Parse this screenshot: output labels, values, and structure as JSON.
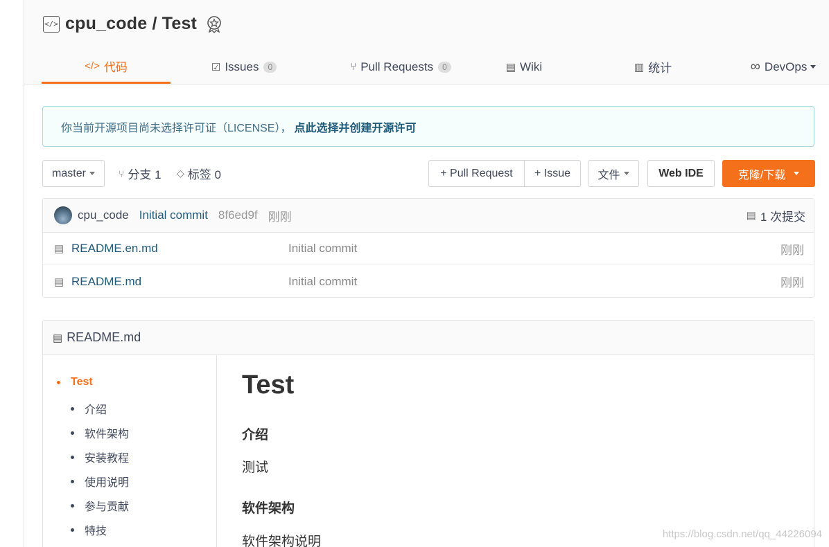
{
  "repo": {
    "title": "cpu_code / Test",
    "repo_icon": "repo-code-icon",
    "badge_icon": "award-badge-icon"
  },
  "tabs": [
    {
      "label": "代码",
      "icon": "code-icon",
      "active": true
    },
    {
      "label": "Issues",
      "icon": "issues-icon",
      "count": "0"
    },
    {
      "label": "Pull Requests",
      "icon": "pull-request-icon",
      "count": "0"
    },
    {
      "label": "Wiki",
      "icon": "book-icon"
    },
    {
      "label": "统计",
      "icon": "bar-chart-icon"
    },
    {
      "label": "DevOps",
      "icon": "infinity-icon"
    }
  ],
  "alert": {
    "text": "你当前开源项目尚未选择许可证（LICENSE），",
    "link": "点此选择并创建开源许可"
  },
  "toolbar": {
    "branch": "master",
    "branches_label": "分支 1",
    "tags_label": "标签 0",
    "pull_request_button": "+ Pull Request",
    "issue_button": "+ Issue",
    "file_button": "文件",
    "web_ide_button": "Web IDE",
    "clone_button": "克隆/下载"
  },
  "commit": {
    "author": "cpu_code",
    "message": "Initial commit",
    "sha": "8f6ed9f",
    "time": "刚刚",
    "commits_count": "1 次提交"
  },
  "files": [
    {
      "name": "README.en.md",
      "message": "Initial commit",
      "time": "刚刚"
    },
    {
      "name": "README.md",
      "message": "Initial commit",
      "time": "刚刚"
    }
  ],
  "readme": {
    "title": "README.md",
    "toc": [
      {
        "label": "Test",
        "active": true
      },
      {
        "label": "介绍"
      },
      {
        "label": "软件架构"
      },
      {
        "label": "安装教程"
      },
      {
        "label": "使用说明"
      },
      {
        "label": "参与贡献"
      },
      {
        "label": "特技"
      }
    ],
    "h1": "Test",
    "intro_heading": "介绍",
    "intro_text": "测试",
    "arch_heading": "软件架构",
    "arch_text": "软件架构说明"
  },
  "watermark": "https://blog.csdn.net/qq_44226094",
  "colors": {
    "accent": "#f5701b",
    "link": "#1f5b7a",
    "alert_bg": "#f5fdfd",
    "alert_border": "#a8d8e0"
  }
}
